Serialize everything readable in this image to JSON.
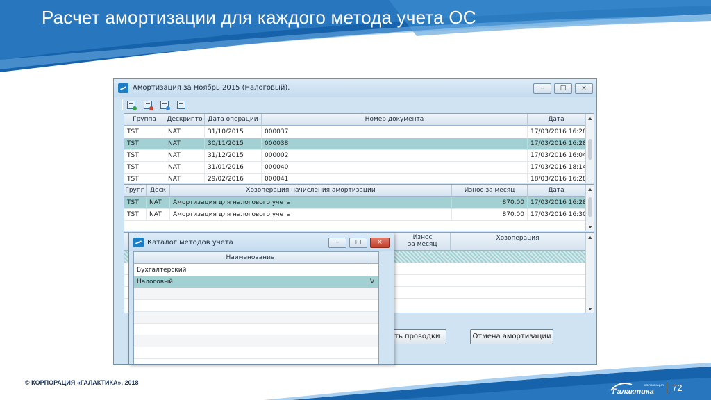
{
  "slide": {
    "title": "Расчет амортизации для каждого метода учета ОС",
    "copyright": "© КОРПОРАЦИЯ «ГАЛАКТИКА», 2018",
    "brand": "Галактика",
    "brand_small": "КОРПОРАЦИЯ",
    "page_number": "72"
  },
  "window": {
    "title": "Амортизация за Ноябрь 2015 (Налоговый).",
    "buttons": [
      "–",
      "□",
      "×"
    ],
    "toolbar_icons": [
      "report-icon",
      "document-add-icon",
      "copy-icon",
      "table-icon"
    ]
  },
  "grid1": {
    "columns": [
      "Группа",
      "Дескрипто",
      "Дата операции",
      "Номер документа",
      "Дата"
    ],
    "rows": [
      {
        "group": "TST",
        "desc": "NAT",
        "op_date": "31/10/2015",
        "doc": "000037",
        "date": "17/03/2016 16:28",
        "selected": false
      },
      {
        "group": "TST",
        "desc": "NAT",
        "op_date": "30/11/2015",
        "doc": "000038",
        "date": "17/03/2016 16:28",
        "selected": true
      },
      {
        "group": "TST",
        "desc": "NAT",
        "op_date": "31/12/2015",
        "doc": "000002",
        "date": "17/03/2016 16:04",
        "selected": false
      },
      {
        "group": "TST",
        "desc": "NAT",
        "op_date": "31/01/2016",
        "doc": "000040",
        "date": "17/03/2016 18:14",
        "selected": false
      },
      {
        "group": "TST",
        "desc": "NAT",
        "op_date": "29/02/2016",
        "doc": "000041",
        "date": "18/03/2016 16:28",
        "selected": false
      }
    ]
  },
  "grid2": {
    "columns": [
      "Групп",
      "Деск",
      "Хозоперация начисления амортизации",
      "Износ за месяц",
      "Дата"
    ],
    "rows": [
      {
        "group": "TST",
        "desc": "NAT",
        "op": "Амортизация для налогового учета",
        "wear": "870.00",
        "date": "17/03/2016 16:28",
        "selected": true
      },
      {
        "group": "TST",
        "desc": "NAT",
        "op": "Амортизация для налогового учета",
        "wear": "870.00",
        "date": "17/03/2016 16:30",
        "selected": false
      }
    ]
  },
  "grid3": {
    "columns": [
      "Износ\nза месяц",
      "Хозоперация"
    ]
  },
  "buttons": {
    "post": "…ать проводки",
    "cancel": "Отмена амортизации"
  },
  "dialog": {
    "title": "Каталог методов учета",
    "buttons": [
      "–",
      "□",
      "×"
    ],
    "column": "Наименование",
    "rows": [
      {
        "name": "Бухгалтерский",
        "mark": "",
        "selected": false
      },
      {
        "name": "Налоговый",
        "mark": "V",
        "selected": true
      }
    ]
  },
  "colors": {
    "header_blue": "#1a5fa3",
    "selection": "#a3d0d3",
    "window_bg": "#cfe3f2"
  }
}
